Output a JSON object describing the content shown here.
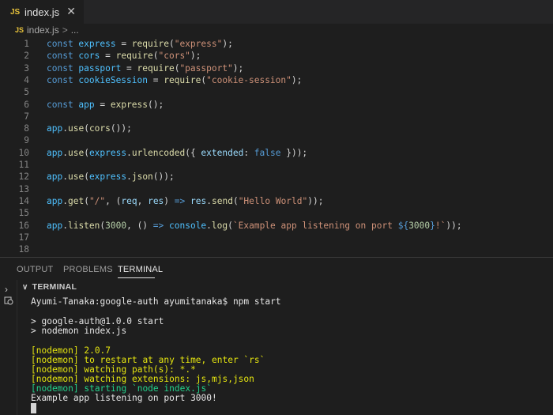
{
  "tab": {
    "badge": "JS",
    "filename": "index.js",
    "close": "✕"
  },
  "breadcrumb": {
    "badge": "JS",
    "file": "index.js",
    "separator": ">",
    "rest": "..."
  },
  "editor": {
    "line_numbers": [
      "1",
      "2",
      "3",
      "4",
      "5",
      "6",
      "7",
      "8",
      "9",
      "10",
      "11",
      "12",
      "13",
      "14",
      "15",
      "16",
      "17",
      "18"
    ],
    "lines": [
      [
        {
          "t": "const ",
          "c": "kw"
        },
        {
          "t": "express",
          "c": "cv"
        },
        {
          "t": " = ",
          "c": "pl"
        },
        {
          "t": "require",
          "c": "fn"
        },
        {
          "t": "(",
          "c": "pl"
        },
        {
          "t": "\"express\"",
          "c": "st"
        },
        {
          "t": ");",
          "c": "pl"
        }
      ],
      [
        {
          "t": "const ",
          "c": "kw"
        },
        {
          "t": "cors",
          "c": "cv"
        },
        {
          "t": " = ",
          "c": "pl"
        },
        {
          "t": "require",
          "c": "fn"
        },
        {
          "t": "(",
          "c": "pl"
        },
        {
          "t": "\"cors\"",
          "c": "st"
        },
        {
          "t": ");",
          "c": "pl"
        }
      ],
      [
        {
          "t": "const ",
          "c": "kw"
        },
        {
          "t": "passport",
          "c": "cv"
        },
        {
          "t": " = ",
          "c": "pl"
        },
        {
          "t": "require",
          "c": "fn"
        },
        {
          "t": "(",
          "c": "pl"
        },
        {
          "t": "\"passport\"",
          "c": "st"
        },
        {
          "t": ");",
          "c": "pl"
        }
      ],
      [
        {
          "t": "const ",
          "c": "kw"
        },
        {
          "t": "cookieSession",
          "c": "cv"
        },
        {
          "t": " = ",
          "c": "pl"
        },
        {
          "t": "require",
          "c": "fn"
        },
        {
          "t": "(",
          "c": "pl"
        },
        {
          "t": "\"cookie-session\"",
          "c": "st"
        },
        {
          "t": ");",
          "c": "pl"
        }
      ],
      [],
      [
        {
          "t": "const ",
          "c": "kw"
        },
        {
          "t": "app",
          "c": "cv"
        },
        {
          "t": " = ",
          "c": "pl"
        },
        {
          "t": "express",
          "c": "fn"
        },
        {
          "t": "();",
          "c": "pl"
        }
      ],
      [],
      [
        {
          "t": "app",
          "c": "cv"
        },
        {
          "t": ".",
          "c": "pl"
        },
        {
          "t": "use",
          "c": "fn"
        },
        {
          "t": "(",
          "c": "pl"
        },
        {
          "t": "cors",
          "c": "fn"
        },
        {
          "t": "());",
          "c": "pl"
        }
      ],
      [],
      [
        {
          "t": "app",
          "c": "cv"
        },
        {
          "t": ".",
          "c": "pl"
        },
        {
          "t": "use",
          "c": "fn"
        },
        {
          "t": "(",
          "c": "pl"
        },
        {
          "t": "express",
          "c": "cv"
        },
        {
          "t": ".",
          "c": "pl"
        },
        {
          "t": "urlencoded",
          "c": "fn"
        },
        {
          "t": "({ ",
          "c": "pl"
        },
        {
          "t": "extended",
          "c": "vr"
        },
        {
          "t": ": ",
          "c": "pl"
        },
        {
          "t": "false",
          "c": "kw"
        },
        {
          "t": " }));",
          "c": "pl"
        }
      ],
      [],
      [
        {
          "t": "app",
          "c": "cv"
        },
        {
          "t": ".",
          "c": "pl"
        },
        {
          "t": "use",
          "c": "fn"
        },
        {
          "t": "(",
          "c": "pl"
        },
        {
          "t": "express",
          "c": "cv"
        },
        {
          "t": ".",
          "c": "pl"
        },
        {
          "t": "json",
          "c": "fn"
        },
        {
          "t": "());",
          "c": "pl"
        }
      ],
      [],
      [
        {
          "t": "app",
          "c": "cv"
        },
        {
          "t": ".",
          "c": "pl"
        },
        {
          "t": "get",
          "c": "fn"
        },
        {
          "t": "(",
          "c": "pl"
        },
        {
          "t": "\"/\"",
          "c": "st"
        },
        {
          "t": ", (",
          "c": "pl"
        },
        {
          "t": "req",
          "c": "vr"
        },
        {
          "t": ", ",
          "c": "pl"
        },
        {
          "t": "res",
          "c": "vr"
        },
        {
          "t": ") ",
          "c": "pl"
        },
        {
          "t": "=>",
          "c": "kw"
        },
        {
          "t": " ",
          "c": "pl"
        },
        {
          "t": "res",
          "c": "vr"
        },
        {
          "t": ".",
          "c": "pl"
        },
        {
          "t": "send",
          "c": "fn"
        },
        {
          "t": "(",
          "c": "pl"
        },
        {
          "t": "\"Hello World\"",
          "c": "st"
        },
        {
          "t": "));",
          "c": "pl"
        }
      ],
      [],
      [
        {
          "t": "app",
          "c": "cv"
        },
        {
          "t": ".",
          "c": "pl"
        },
        {
          "t": "listen",
          "c": "fn"
        },
        {
          "t": "(",
          "c": "pl"
        },
        {
          "t": "3000",
          "c": "nm"
        },
        {
          "t": ", () ",
          "c": "pl"
        },
        {
          "t": "=>",
          "c": "kw"
        },
        {
          "t": " ",
          "c": "pl"
        },
        {
          "t": "console",
          "c": "cv"
        },
        {
          "t": ".",
          "c": "pl"
        },
        {
          "t": "log",
          "c": "fn"
        },
        {
          "t": "(",
          "c": "pl"
        },
        {
          "t": "`Example app listening on port ",
          "c": "st"
        },
        {
          "t": "${",
          "c": "kw"
        },
        {
          "t": "3000",
          "c": "nm"
        },
        {
          "t": "}",
          "c": "kw"
        },
        {
          "t": "!`",
          "c": "st"
        },
        {
          "t": "));",
          "c": "pl"
        }
      ],
      [],
      []
    ]
  },
  "panel": {
    "tabs": [
      "OUTPUT",
      "PROBLEMS",
      "TERMINAL"
    ],
    "active_tab": "TERMINAL"
  },
  "terminal": {
    "header": "TERMINAL",
    "lines": [
      {
        "text": "Ayumi-Tanaka:google-auth ayumitanaka$ npm start",
        "color": "white"
      },
      {
        "text": "",
        "color": "white"
      },
      {
        "text": "> google-auth@1.0.0 start",
        "color": "white"
      },
      {
        "text": "> nodemon index.js",
        "color": "white"
      },
      {
        "text": "",
        "color": "white"
      },
      {
        "text": "[nodemon] 2.0.7",
        "color": "yellow"
      },
      {
        "text": "[nodemon] to restart at any time, enter `rs`",
        "color": "yellow"
      },
      {
        "text": "[nodemon] watching path(s): *.*",
        "color": "yellow"
      },
      {
        "text": "[nodemon] watching extensions: js,mjs,json",
        "color": "yellow"
      },
      {
        "text": "[nodemon] starting `node index.js`",
        "color": "green"
      },
      {
        "text": "Example app listening on port 3000!",
        "color": "white"
      }
    ]
  },
  "colors": {
    "background": "#1e1e1e",
    "tabbar": "#252526",
    "js_badge": "#e8c33b",
    "terminal_yellow": "#e5e510",
    "terminal_green": "#23d18b"
  }
}
